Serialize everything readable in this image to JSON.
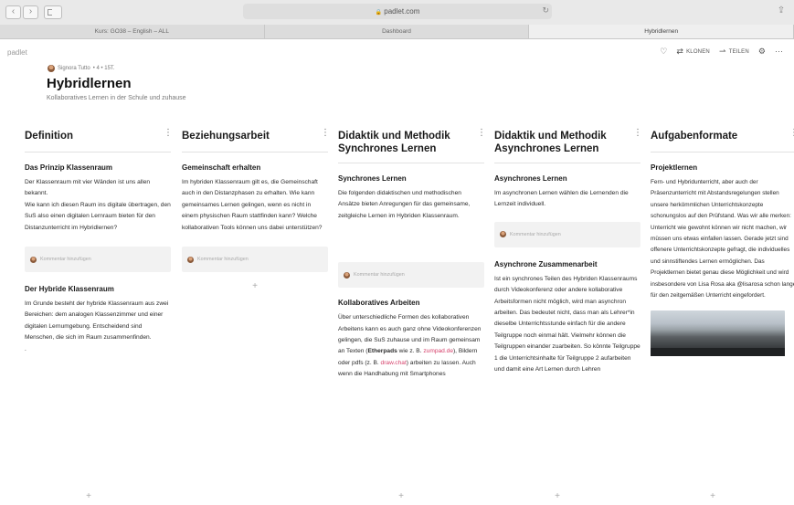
{
  "browser": {
    "url": "padlet.com",
    "tabs": [
      {
        "label": "Kurs: GO38 – English – ALL",
        "active": false
      },
      {
        "label": "Dashboard",
        "active": false
      },
      {
        "label": "Hybridlernen",
        "active": true
      }
    ]
  },
  "app": {
    "brand": "padlet",
    "toolbar": {
      "clone_label": "KLONEN",
      "share_label": "TEILEN"
    }
  },
  "board": {
    "author": "Signora Tutto",
    "author_meta": "• 4 • 15T.",
    "title": "Hybridlernen",
    "subtitle": "Kollaboratives Lernen in der Schule und zuhause"
  },
  "comment_placeholder": "Kommentar hinzufügen",
  "columns": [
    {
      "title": "Definition",
      "posts": [
        {
          "title": "Das Prinzip Klassenraum",
          "body": "Der Klassenraum  mit vier Wänden ist uns allen bekannt.\nWie kann ich diesen Raum ins digitale übertragen, den SuS also einen digitalen Lernraum bieten für den Distanzunterricht im Hybridlernen?"
        },
        {
          "title": "Der Hybride Klassenraum",
          "body": "Im Grunde besteht der hybride Klassenraum aus zwei Bereichen: dem analogen Klassenzimmer und einer digitalen Lernumgebung. Entscheidend sind Menschen, die sich im Raum zusammenfinden.\n."
        }
      ]
    },
    {
      "title": "Beziehungsarbeit",
      "posts": [
        {
          "title": "Gemeinschaft erhalten",
          "body": "Im hybriden Klassenraum gilt es, die Gemeinschaft auch in den Distanzphasen zu erhalten. Wie kann gemeinsames Lernen gelingen, wenn es nicht in einem physischen Raum stattfinden kann? Welche kollaborativen Tools können uns dabei unterstützen?"
        }
      ]
    },
    {
      "title": "Didaktik und Methodik Synchrones Lernen",
      "posts": [
        {
          "title": "Synchrones Lernen",
          "body": "Die folgenden didaktischen und methodischen Ansätze bieten Anregungen für das gemeinsame, zeitgleiche Lernen im Hybriden Klassenraum."
        },
        {
          "title": "Kollaboratives Arbeiten",
          "body_a": "Über unterschiedliche Formen des kollaborativen Arbeitens kann es auch ganz ohne Videokonferenzen gelingen, die SuS zuhause und im Raum gemeinsam an Texten (",
          "bold_a": "Etherpads",
          "body_b": " wie z. B. ",
          "link_a": "zumpad.de",
          "body_c": "), Bildern oder pdfs (z. B. ",
          "link_b": "draw.chat",
          "body_d": ") arbeiten zu lassen. Auch wenn die Handhabung mit Smartphones"
        }
      ]
    },
    {
      "title": "Didaktik und Methodik Asynchrones Lernen",
      "posts": [
        {
          "title": "Asynchrones Lernen",
          "body": "Im asynchronen Lernen wählen die Lernenden die Lernzeit individuell."
        },
        {
          "title": "Asynchrone Zusammenarbeit",
          "body": "Ist ein synchrones Teilen des Hybriden Klassenraums durch Videokonferenz oder andere kollaborative Arbeitsformen nicht möglich, wird man asynchron arbeiten. Das bedeutet nicht, dass man als Lehrer*in dieselbe Unterrichtsstunde einfach für die andere Teilgruppe noch einmal hält. Vielmehr können die Teilgruppen einander zuarbeiten. So könnte Teilgruppe 1 die Unterrichtsinhalte für Teilgruppe 2 aufarbeiten und damit eine Art Lernen durch Lehren"
        }
      ]
    },
    {
      "title": "Aufgabenformate",
      "posts": [
        {
          "title": "Projektlernen",
          "body": "Fern- und Hybridunterricht, aber auch der Präsenzunterricht mit Abstandsregelungen stellen unsere herkömmlichen Unterrichtskonzepte schonungslos auf den Prüfstand. Was wir alle merken: Unterricht wie gewohnt können wir nicht machen, wir müssen uns etwas einfallen lassen. Gerade jetzt sind offenere Unterrichtskonzepte gefragt, die individuelles und sinnstiftendes Lernen ermöglichen. Das Projektlernen bietet genau diese Möglichkeit und wird insbesondere von Lisa Rosa aka @lisarosa schon lange für den zeitgemäßen Unterricht eingefordert."
        }
      ]
    }
  ],
  "glyphs": {
    "plus": "+",
    "menu": "⋮",
    "back": "‹",
    "forward": "›",
    "heart": "♡",
    "clone": "⇄",
    "share": "⇀",
    "gear": "⚙",
    "more": "···",
    "reload": "↻",
    "share_sheet": "⇪",
    "lock": "🔒"
  }
}
